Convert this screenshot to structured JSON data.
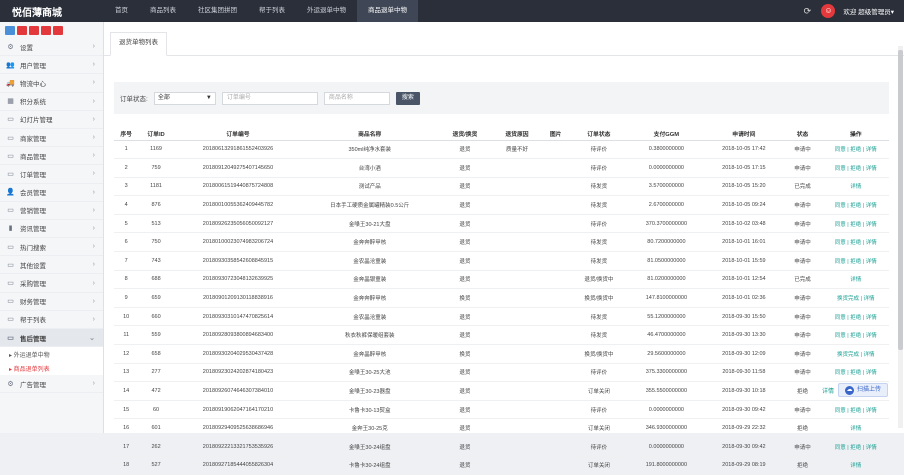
{
  "brand": "悦佰薄商城",
  "nav": [
    "首页",
    "商品列表",
    "社区集团拼团",
    "帮于列表",
    "外运退单中物",
    "商品退单中物"
  ],
  "nav_active": 5,
  "topright": {
    "welcome": "欢迎 超级管理员▾"
  },
  "tool_colors": [
    "#4a90d9",
    "#e4393c",
    "#e4393c",
    "#e4393c",
    "#e4393c"
  ],
  "sidebar": {
    "items": [
      {
        "icon": "gear-icon",
        "glyph": "⚙",
        "label": "设置"
      },
      {
        "icon": "users-icon",
        "glyph": "👥",
        "label": "用户管理"
      },
      {
        "icon": "truck-icon",
        "glyph": "🚚",
        "label": "物流中心"
      },
      {
        "icon": "grid-icon",
        "glyph": "▦",
        "label": "积分系统"
      },
      {
        "icon": "monitor-icon",
        "glyph": "▭",
        "label": "幻灯片管理"
      },
      {
        "icon": "monitor-icon",
        "glyph": "▭",
        "label": "商家管理"
      },
      {
        "icon": "monitor-icon",
        "glyph": "▭",
        "label": "商品管理"
      },
      {
        "icon": "monitor-icon",
        "glyph": "▭",
        "label": "订单管理"
      },
      {
        "icon": "person-icon",
        "glyph": "👤",
        "label": "会员管理"
      },
      {
        "icon": "monitor-icon",
        "glyph": "▭",
        "label": "营销管理"
      },
      {
        "icon": "book-icon",
        "glyph": "▮",
        "label": "资讯管理"
      },
      {
        "icon": "monitor-icon",
        "glyph": "▭",
        "label": "热门搜索"
      },
      {
        "icon": "monitor-icon",
        "glyph": "▭",
        "label": "其他设置"
      },
      {
        "icon": "monitor-icon",
        "glyph": "▭",
        "label": "采购管理"
      },
      {
        "icon": "monitor-icon",
        "glyph": "▭",
        "label": "财务管理"
      },
      {
        "icon": "monitor-icon",
        "glyph": "▭",
        "label": "帮于列表"
      },
      {
        "icon": "monitor-icon",
        "glyph": "▭",
        "label": "售后管理"
      }
    ],
    "subitems": [
      "▸ 外运退单中物",
      "▸ 商品退单列表"
    ],
    "last": {
      "icon": "gear-icon",
      "glyph": "⚙",
      "label": "广告管理"
    }
  },
  "tab_label": "退货单物列表",
  "filter": {
    "status_label": "订单状态:",
    "status_value": "全部",
    "order_placeholder": "订单编号",
    "goods_placeholder": "商品名称",
    "search_label": "搜索"
  },
  "table": {
    "headers": [
      "序号",
      "订单ID",
      "订单编号",
      "商品名称",
      "退货/换货",
      "退货原因",
      "图片",
      "订单状态",
      "支付GGM",
      "申请时间",
      "状态",
      "操作"
    ],
    "rows": [
      [
        "1",
        "1169",
        "20180613291861552403926",
        "350ml纯净水套装",
        "退货",
        "质量不好",
        "",
        "待评价",
        "0.3800000000",
        "2018-10-05 17:42",
        "申请中",
        "同意 | 拒绝 | 详情"
      ],
      [
        "2",
        "759",
        "20180912049275407145650",
        "台湾小酒",
        "退货",
        "",
        "",
        "待评价",
        "0.0000000000",
        "2018-10-05 17:15",
        "申请中",
        "同意 | 拒绝 | 详情"
      ],
      [
        "3",
        "1181",
        "20180061519440875724808",
        "测试产品",
        "退货",
        "",
        "",
        "待发货",
        "3.5700000000",
        "2018-10-05 15:20",
        "已完成",
        "详情"
      ],
      [
        "4",
        "876",
        "20180010055362409445782",
        "日本手工硬质金属罐精装0.5公斤",
        "退货",
        "",
        "",
        "待发货",
        "2.6700000000",
        "2018-10-05 09:24",
        "申请中",
        "同意 | 拒绝 | 详情"
      ],
      [
        "5",
        "513",
        "20180926235056050092127",
        "金嗓王30-21大盘",
        "退货",
        "",
        "",
        "待评价",
        "370.3700000000",
        "2018-10-02 03:48",
        "申请中",
        "同意 | 拒绝 | 详情"
      ],
      [
        "6",
        "750",
        "20180100023074983206724",
        "金奔奔醉甲核",
        "退货",
        "",
        "",
        "待发货",
        "80.7200000000",
        "2018-10-01 16:01",
        "申请中",
        "同意 | 拒绝 | 详情"
      ],
      [
        "7",
        "743",
        "20180930358542608845915",
        "金农晶沧童装",
        "退货",
        "",
        "",
        "待发货",
        "81.0500000000",
        "2018-10-01 15:59",
        "申请中",
        "同意 | 拒绝 | 详情"
      ],
      [
        "8",
        "688",
        "20180930723048132639925",
        "金奔晶银童装",
        "退货",
        "",
        "",
        "退货/换货中",
        "81.0200000000",
        "2018-10-01 12:54",
        "已完成",
        "详情"
      ],
      [
        "9",
        "659",
        "20180901209130118838916",
        "金奔奔醉甲核",
        "换货",
        "",
        "",
        "换货/换货中",
        "147.8100000000",
        "2018-10-01 02:36",
        "申请中",
        "换货完成 | 详情"
      ],
      [
        "10",
        "660",
        "20180930310147470825614",
        "金农晶沧童装",
        "退货",
        "",
        "",
        "待发货",
        "55.1200000000",
        "2018-09-30 15:50",
        "申请中",
        "同意 | 拒绝 | 详情"
      ],
      [
        "11",
        "559",
        "20180928093800894683400",
        "秋衣秋裤保暖组套装",
        "退货",
        "",
        "",
        "待发货",
        "46.4700000000",
        "2018-09-30 13:30",
        "申请中",
        "同意 | 拒绝 | 详情"
      ],
      [
        "12",
        "658",
        "20180930204029530437428",
        "金奔晶醉甲核",
        "换货",
        "",
        "",
        "换货/换货中",
        "29.5600000000",
        "2018-09-30 12:09",
        "申请中",
        "换货完成 | 详情"
      ],
      [
        "13",
        "277",
        "20180923024202874180423",
        "金嗓王30-25大池",
        "退货",
        "",
        "",
        "待评价",
        "375.3300000000",
        "2018-09-30 11:58",
        "申请中",
        "同意 | 拒绝 | 详情"
      ],
      [
        "14",
        "472",
        "20180926074646307384010",
        "金嗓王30-23器盘",
        "退货",
        "",
        "",
        "订单关闭",
        "355.5500000000",
        "2018-09-30 10:18",
        "拒绝",
        "详情"
      ],
      [
        "15",
        "60",
        "20180919062047164170210",
        "卡鲁卡30-13熨盒",
        "退货",
        "",
        "",
        "待评价",
        "0.0000000000",
        "2018-09-30 09:42",
        "申请中",
        "同意 | 拒绝 | 详情"
      ],
      [
        "16",
        "601",
        "20180929409525638686946",
        "金奔王30-25克",
        "退货",
        "",
        "",
        "订单关闭",
        "346.9300000000",
        "2018-09-29 22:32",
        "拒绝",
        "详情"
      ],
      [
        "17",
        "262",
        "20180922213321753535926",
        "金嗓王30-24组盘",
        "退货",
        "",
        "",
        "待评价",
        "0.0000000000",
        "2018-09-30 09:42",
        "申请中",
        "同意 | 拒绝 | 详情"
      ],
      [
        "18",
        "527",
        "20180927185444055826304",
        "卡鲁卡30-24组盘",
        "退货",
        "",
        "",
        "订单关闭",
        "191.8000000000",
        "2018-09-29 08:19",
        "拒绝",
        "详情"
      ]
    ]
  },
  "float": {
    "share": "详情",
    "badge": "扫描上传"
  }
}
